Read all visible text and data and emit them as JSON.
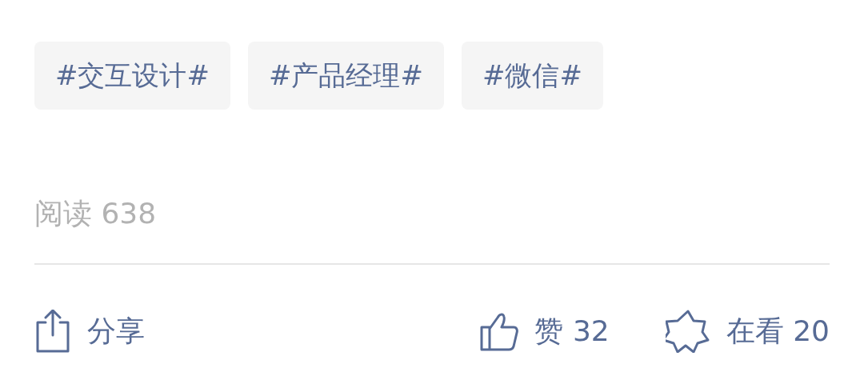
{
  "tags": [
    "#交互设计#",
    "#产品经理#",
    "#微信#"
  ],
  "reads": "阅读 638",
  "actions": {
    "share": "分享",
    "like": "赞 32",
    "watching": "在看 20"
  }
}
